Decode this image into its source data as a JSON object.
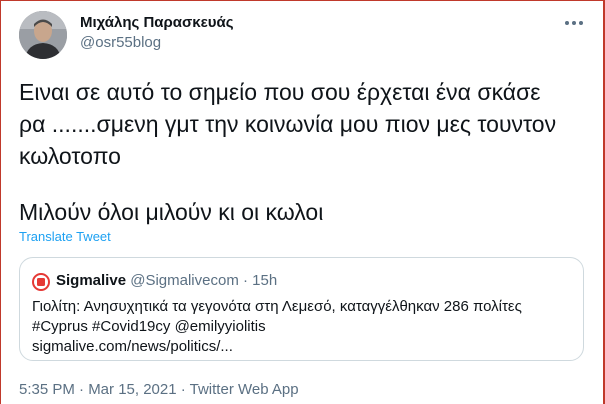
{
  "author": {
    "name": "Μιχάλης Παρασκευάς",
    "handle": "@osr55blog",
    "avatar_icon": "user-avatar"
  },
  "more_icon": "ellipsis-icon",
  "tweet": {
    "lines": [
      "Ειναι σε αυτό το σημείο που σου έρχεται ένα σκάσε",
      "ρα .......σμενη γμτ την κοινωνία μου πιον μες τουντον",
      "κωλοτοπο"
    ],
    "second_paragraph": "Μιλούν όλοι μιλούν κι οι κωλοι"
  },
  "translate_label": "Translate Tweet",
  "quoted": {
    "logo_icon": "sigmalive-logo",
    "name": "Sigmalive",
    "handle": "@Sigmalivecom",
    "separator": "·",
    "time": "15h",
    "lines": [
      "Γιολίτη: Ανησυχητικά τα γεγονότα στη Λεμεσό, καταγγέλθηκαν 286 πολίτες",
      "#Cyprus #Covid19cy @emilyyiolitis",
      "sigmalive.com/news/politics/..."
    ]
  },
  "meta": {
    "text": "5:35 PM · Mar 15, 2021 · Twitter Web App"
  },
  "colors": {
    "link_blue": "#1da1f2",
    "secondary_text": "#5b7083",
    "border": "#cfd9de",
    "frame_red": "#c0392b",
    "logo_red": "#e53935"
  }
}
